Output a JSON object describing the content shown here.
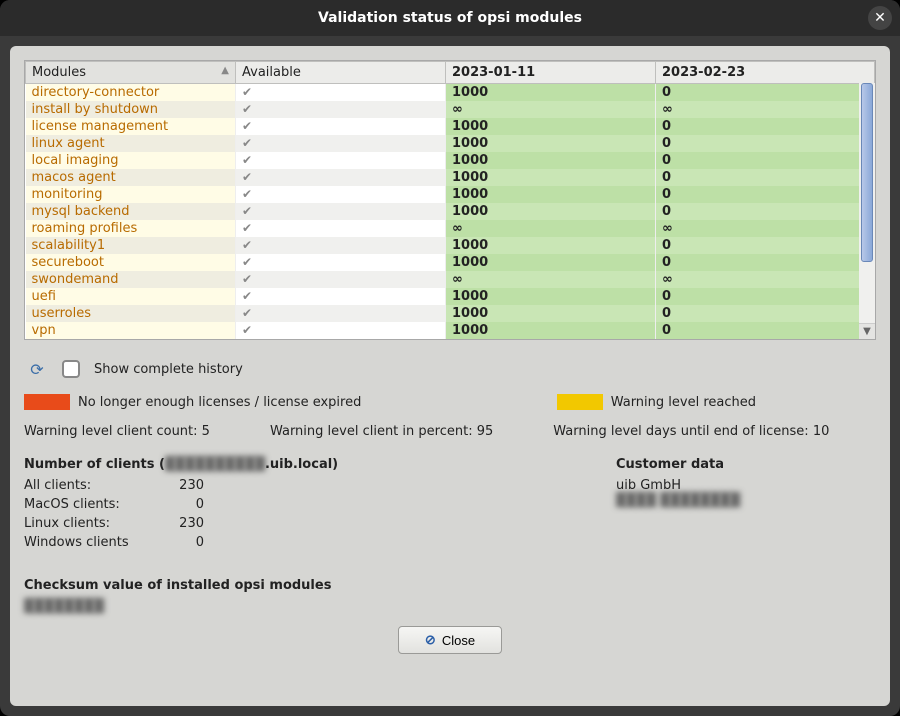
{
  "title": "Validation status of opsi modules",
  "columns": [
    "Modules",
    "Available",
    "2023-01-11",
    "2023-02-23"
  ],
  "rows": [
    {
      "name": "directory-connector",
      "avail": true,
      "c1": "1000",
      "c2": "0"
    },
    {
      "name": "install by shutdown",
      "avail": true,
      "c1": "∞",
      "c2": "∞"
    },
    {
      "name": "license management",
      "avail": true,
      "c1": "1000",
      "c2": "0"
    },
    {
      "name": "linux agent",
      "avail": true,
      "c1": "1000",
      "c2": "0"
    },
    {
      "name": "local imaging",
      "avail": true,
      "c1": "1000",
      "c2": "0"
    },
    {
      "name": "macos agent",
      "avail": true,
      "c1": "1000",
      "c2": "0"
    },
    {
      "name": "monitoring",
      "avail": true,
      "c1": "1000",
      "c2": "0"
    },
    {
      "name": "mysql backend",
      "avail": true,
      "c1": "1000",
      "c2": "0"
    },
    {
      "name": "roaming profiles",
      "avail": true,
      "c1": "∞",
      "c2": "∞"
    },
    {
      "name": "scalability1",
      "avail": true,
      "c1": "1000",
      "c2": "0"
    },
    {
      "name": "secureboot",
      "avail": true,
      "c1": "1000",
      "c2": "0"
    },
    {
      "name": "swondemand",
      "avail": true,
      "c1": "∞",
      "c2": "∞"
    },
    {
      "name": "uefi",
      "avail": true,
      "c1": "1000",
      "c2": "0"
    },
    {
      "name": "userroles",
      "avail": true,
      "c1": "1000",
      "c2": "0"
    },
    {
      "name": "vpn",
      "avail": true,
      "c1": "1000",
      "c2": "0"
    }
  ],
  "toolbar": {
    "history_label": "Show complete history"
  },
  "legend": {
    "red": "No longer enough licenses / license expired",
    "yellow": "Warning level reached"
  },
  "warnings": {
    "count_label": "Warning level client count:",
    "count": "5",
    "percent_label": "Warning level client in percent:",
    "percent": "95",
    "days_label": "Warning level days until end of license:",
    "days": "10"
  },
  "clients": {
    "heading_prefix": "Number of clients (",
    "heading_host_masked": "██████████",
    "heading_suffix": ".uib.local)",
    "rows": [
      {
        "k": "All clients:",
        "v": "230"
      },
      {
        "k": "MacOS clients:",
        "v": "0"
      },
      {
        "k": "Linux clients:",
        "v": "230"
      },
      {
        "k": "Windows clients",
        "v": "0"
      }
    ]
  },
  "customer": {
    "heading": "Customer data",
    "name": "uib GmbH",
    "line2_masked": "████ ████████"
  },
  "checksum": {
    "heading": "Checksum value of installed opsi modules",
    "value_masked": "████████"
  },
  "close_label": "Close"
}
